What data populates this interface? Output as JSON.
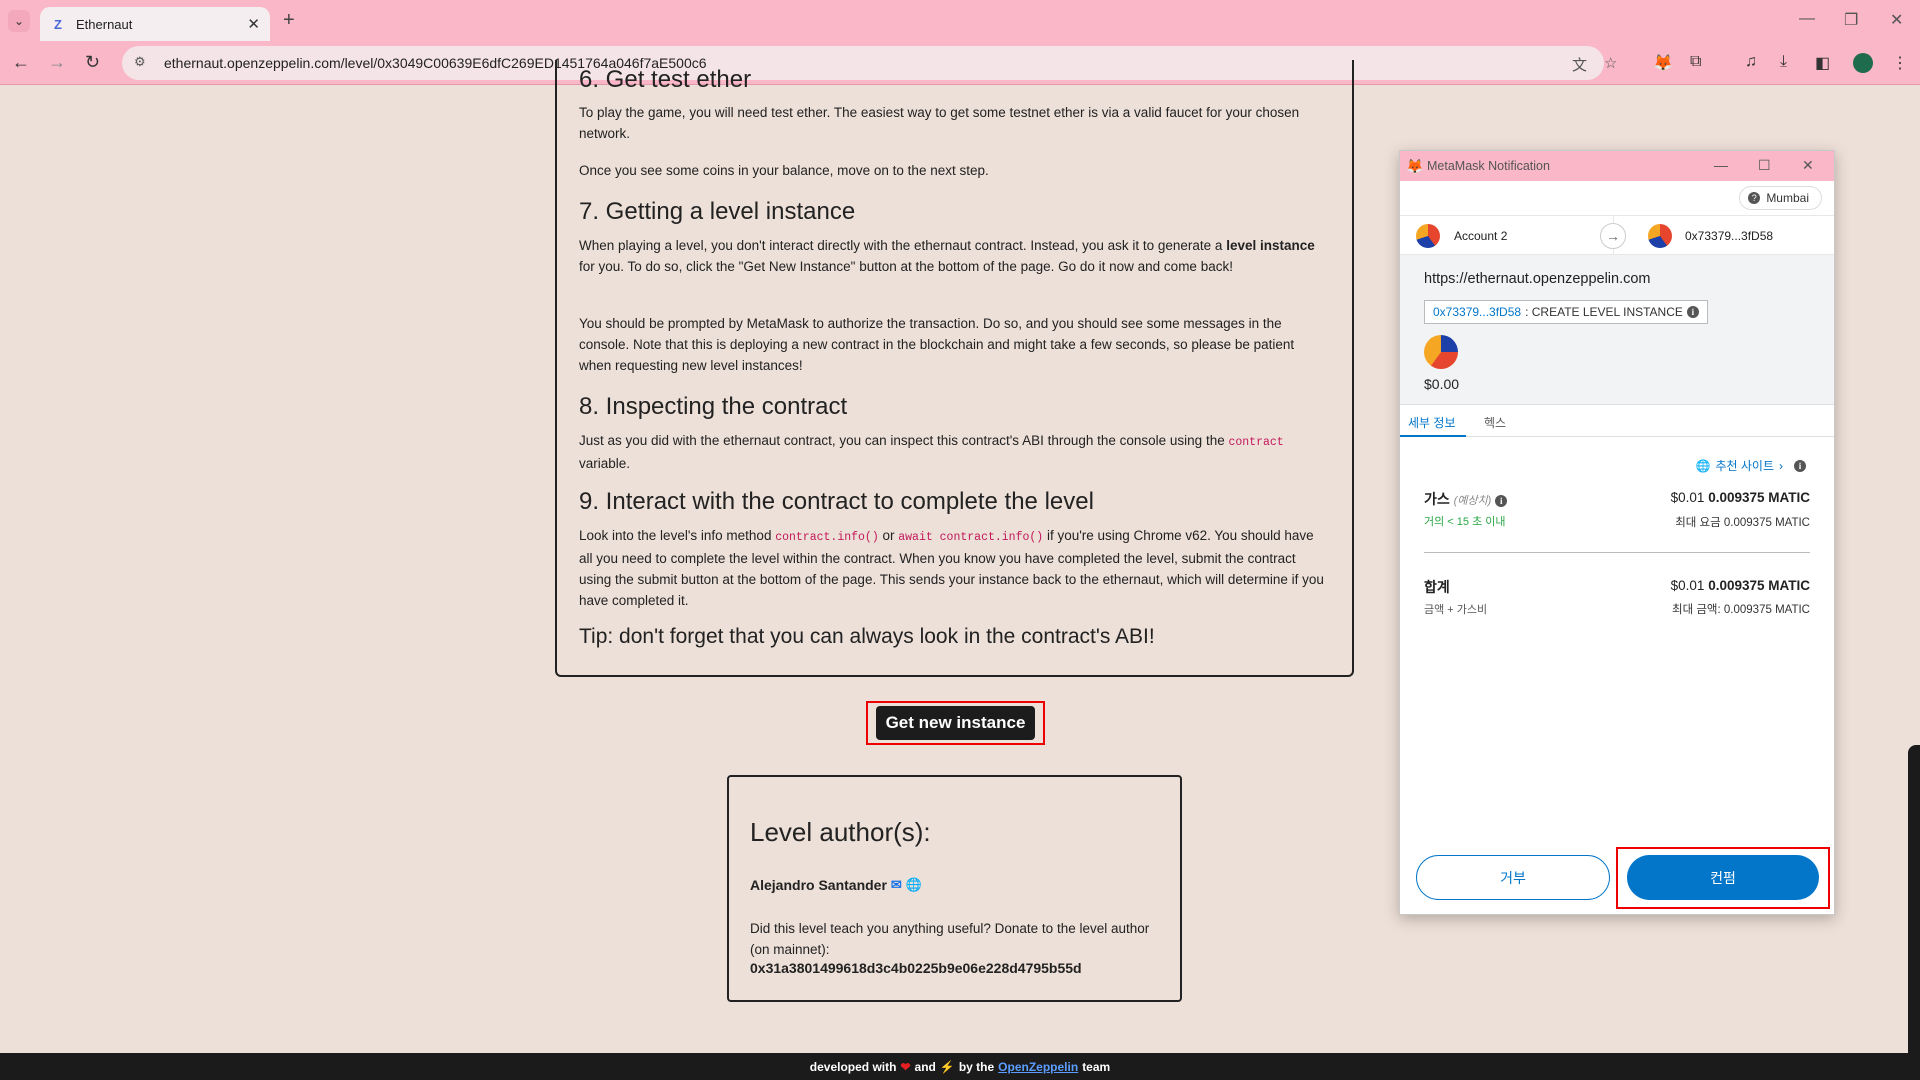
{
  "browser": {
    "tab_title": "Ethernaut",
    "tab_favicon": "Z",
    "url": "ethernaut.openzeppelin.com/level/0x3049C00639E6dfC269ED1451764a046f7aE500c6"
  },
  "page": {
    "cut_heading": "6. Get test ether",
    "get_test_ether": {
      "p1": "To play the game, you will need test ether. The easiest way to get some testnet ether is via a valid faucet for your chosen network.",
      "p2": "Once you see some coins in your balance, move on to the next step."
    },
    "section7": {
      "heading": "7. Getting a level instance",
      "p1_a": "When playing a level, you don't interact directly with the ethernaut contract. Instead, you ask it to generate a ",
      "p1_bold": "level instance",
      "p1_b": " for you. To do so, click the \"Get New Instance\" button at the bottom of the page. Go do it now and come back!",
      "p2": "You should be prompted by MetaMask to authorize the transaction. Do so, and you should see some messages in the console. Note that this is deploying a new contract in the blockchain and might take a few seconds, so please be patient when requesting new level instances!"
    },
    "section8": {
      "heading": "8. Inspecting the contract",
      "p1_a": "Just as you did with the ethernaut contract, you can inspect this contract's ABI through the console using the ",
      "code": "contract",
      "p1_b": " variable."
    },
    "section9": {
      "heading": "9. Interact with the contract to complete the level",
      "p1_a": "Look into the level's info method ",
      "code1": "contract.info()",
      "p1_or": " or ",
      "code2": "await contract.info()",
      "p1_b": " if you're using Chrome v62. You should have all you need to complete the level within the contract. When you know you have completed the level, submit the contract using the submit button at the bottom of the page. This sends your instance back to the ethernaut, which will determine if you have completed it."
    },
    "tip": "Tip: don't forget that you can always look in the contract's ABI!",
    "get_instance_button": "Get new instance",
    "author": {
      "heading": "Level author(s):",
      "name": "Alejandro Santander",
      "donate": "Did this level teach you anything useful? Donate to the level author (on mainnet):",
      "address": "0x31a3801499618d3c4b0225b9e06e228d4795b55d"
    },
    "footer": {
      "pre": "developed with",
      "and": "and",
      "by": "by the",
      "link": "OpenZeppelin",
      "post": "team"
    }
  },
  "metamask": {
    "window_title": "MetaMask Notification",
    "network": "Mumbai",
    "from_account": "Account 2",
    "to_account": "0x73379...3fD58",
    "origin": "https://ethernaut.openzeppelin.com",
    "method_address": "0x73379...3fD58",
    "method_name": ": CREATE LEVEL INSTANCE",
    "value": "$0.00",
    "tabs": [
      "세부 정보",
      "헥스"
    ],
    "recommended_site": "추천 사이트",
    "gas": {
      "label": "가스",
      "estimated": "(예상치)",
      "speed": "거의 < 15 초 이내",
      "fiat": "$0.01",
      "amount": "0.009375 MATIC",
      "max_label": "최대 요금",
      "max_amount": "0.009375 MATIC"
    },
    "total": {
      "label": "합계",
      "sub": "금액 + 가스비",
      "fiat": "$0.01",
      "amount": "0.009375 MATIC",
      "max_label": "최대 금액:",
      "max_amount": "0.009375 MATIC"
    },
    "reject_button": "거부",
    "confirm_button": "컨펌"
  },
  "colors": {
    "browser_chrome": "#f9b7c8",
    "page_bg": "#ede0d8",
    "metamask_blue": "#0376c9",
    "highlight_red": "#ee0000"
  }
}
